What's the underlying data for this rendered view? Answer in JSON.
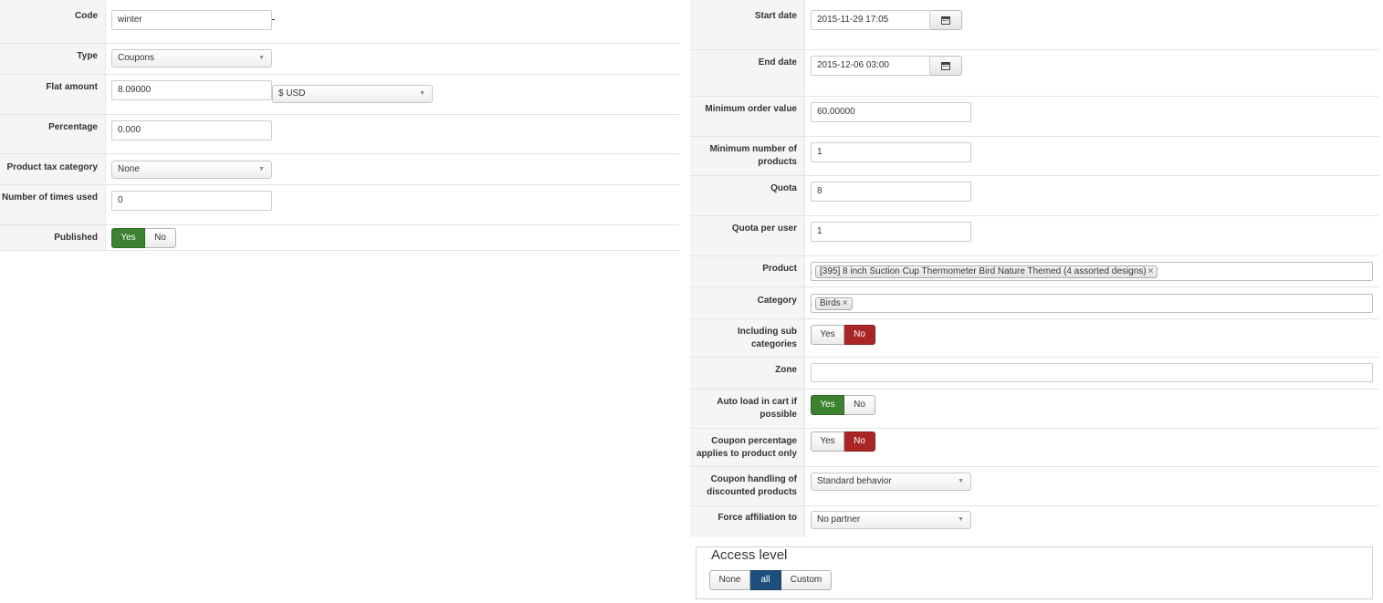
{
  "left": {
    "code": {
      "label": "Code",
      "value": "winter"
    },
    "type": {
      "label": "Type",
      "value": "Coupons"
    },
    "flat_amount": {
      "label": "Flat amount",
      "value": "8.09000",
      "currency": "$ USD"
    },
    "percentage": {
      "label": "Percentage",
      "value": "0.000"
    },
    "product_tax_category": {
      "label": "Product tax category",
      "value": "None"
    },
    "times_used": {
      "label": "Number of times used",
      "value": "0"
    },
    "published": {
      "label": "Published",
      "yes": "Yes",
      "no": "No",
      "selected": "Yes"
    }
  },
  "right": {
    "start_date": {
      "label": "Start date",
      "value": "2015-11-29 17:05"
    },
    "end_date": {
      "label": "End date",
      "value": "2015-12-06 03:00"
    },
    "min_order_value": {
      "label": "Minimum order value",
      "value": "60.00000"
    },
    "min_products": {
      "label_1": "Minimum number of",
      "label_2": "products",
      "value": "1"
    },
    "quota": {
      "label": "Quota",
      "value": "8"
    },
    "quota_per_user": {
      "label": "Quota per user",
      "value": "1"
    },
    "product": {
      "label": "Product",
      "tag": "[395] 8 inch Suction Cup Thermometer Bird Nature Themed (4 assorted designs)",
      "remove": "×"
    },
    "category": {
      "label": "Category",
      "tag": "Birds",
      "remove": "×"
    },
    "including_sub": {
      "label_1": "Including sub",
      "label_2": "categories",
      "yes": "Yes",
      "no": "No",
      "selected": "No"
    },
    "zone": {
      "label": "Zone",
      "value": ""
    },
    "auto_load": {
      "label_1": "Auto load in cart if",
      "label_2": "possible",
      "yes": "Yes",
      "no": "No",
      "selected": "Yes"
    },
    "coupon_percentage": {
      "label_1": "Coupon percentage",
      "label_2": "applies to product only",
      "yes": "Yes",
      "no": "No",
      "selected": "No"
    },
    "coupon_handling": {
      "label_1": "Coupon handling of",
      "label_2": "discounted products",
      "value": "Standard behavior"
    },
    "force_affiliation": {
      "label": "Force affiliation to",
      "value": "No partner"
    }
  },
  "access_level": {
    "legend": "Access level",
    "options": [
      "None",
      "all",
      "Custom"
    ],
    "selected": "all"
  },
  "icons": {
    "caret": "▼",
    "calendar": "calendar-icon"
  },
  "colors": {
    "yes_active": "#3b8130",
    "no_active": "#aa2626",
    "access_active": "#1e4f7c"
  }
}
